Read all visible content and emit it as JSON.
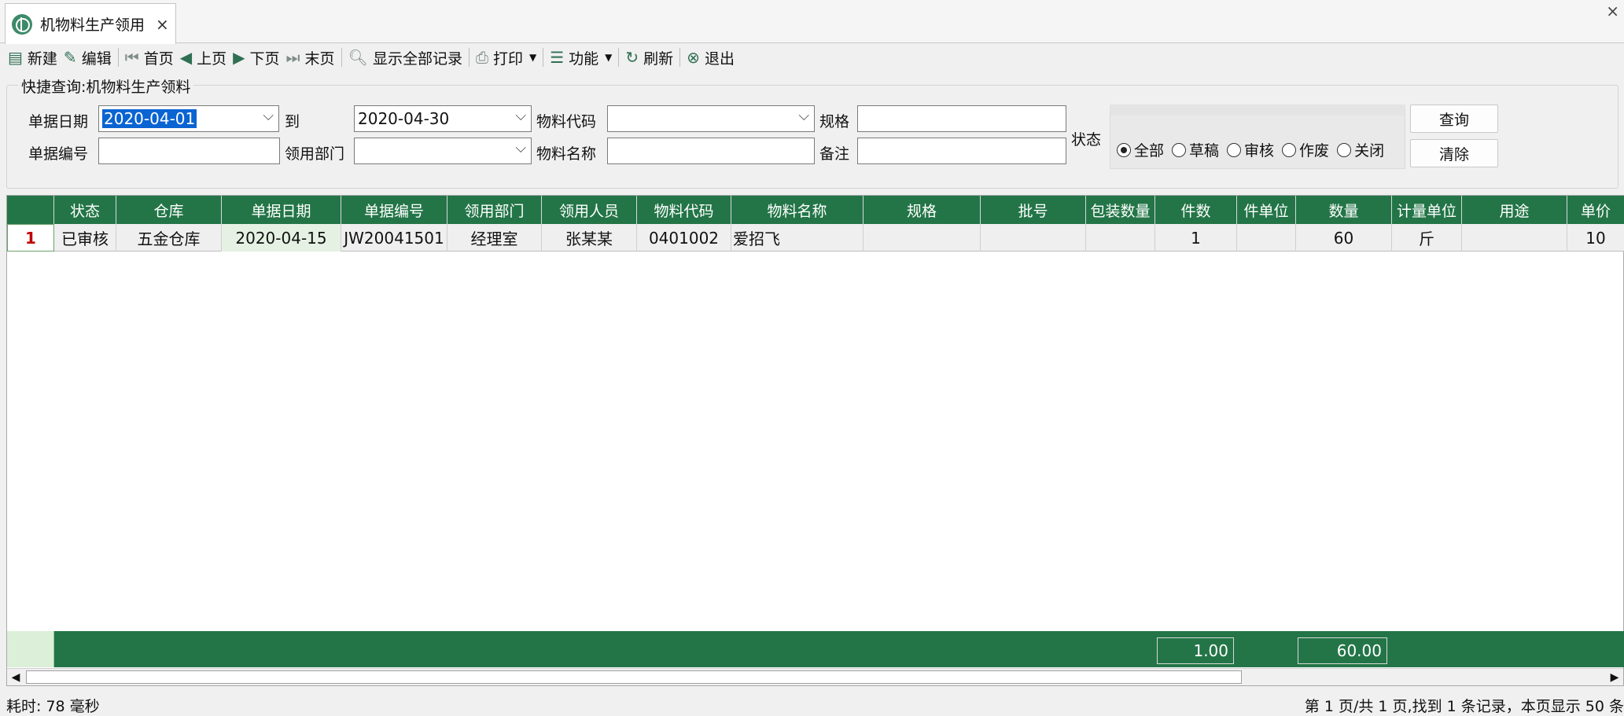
{
  "tab": {
    "title": "机物料生产领用",
    "close": "×"
  },
  "window": {
    "close": "×"
  },
  "toolbar": {
    "new": "新建",
    "edit": "编辑",
    "first": "首页",
    "prev": "上页",
    "next": "下页",
    "last": "末页",
    "show_all": "显示全部记录",
    "print": "打印",
    "function": "功能",
    "refresh": "刷新",
    "exit": "退出"
  },
  "query": {
    "group_title": "快捷查询:机物料生产领料",
    "date_label": "单据日期",
    "date_from": "2020-04-01",
    "to_label": "到",
    "date_to": "2020-04-30",
    "material_code_label": "物料代码",
    "material_code": "",
    "spec_label": "规格",
    "spec": "",
    "doc_no_label": "单据编号",
    "doc_no": "",
    "dept_label": "领用部门",
    "dept": "",
    "material_name_label": "物料名称",
    "material_name": "",
    "remark_label": "备注",
    "remark": "",
    "status_label": "状态",
    "status_options": [
      "全部",
      "草稿",
      "审核",
      "作废",
      "关闭"
    ],
    "status_selected": "全部",
    "search_button": "查询",
    "clear_button": "清除"
  },
  "grid": {
    "columns": [
      "状态",
      "仓库",
      "单据日期",
      "单据编号",
      "领用部门",
      "领用人员",
      "物料代码",
      "物料名称",
      "规格",
      "批号",
      "包装数量",
      "件数",
      "件单位",
      "数量",
      "计量单位",
      "用途",
      "单价"
    ],
    "rows": [
      {
        "num": "1",
        "cells": [
          "已审核",
          "五金仓库",
          "2020-04-15",
          "JW20041501",
          "经理室",
          "张某某",
          "0401002",
          "爱招飞",
          "",
          "",
          "",
          "1",
          "",
          "60",
          "斤",
          "",
          "10"
        ]
      }
    ],
    "totals": {
      "pieces": "1.00",
      "quantity": "60.00"
    }
  },
  "status": {
    "elapsed": "耗时: 78 毫秒",
    "page_info": "第 1 页/共 1 页,找到 1 条记录，本页显示 50 条"
  }
}
